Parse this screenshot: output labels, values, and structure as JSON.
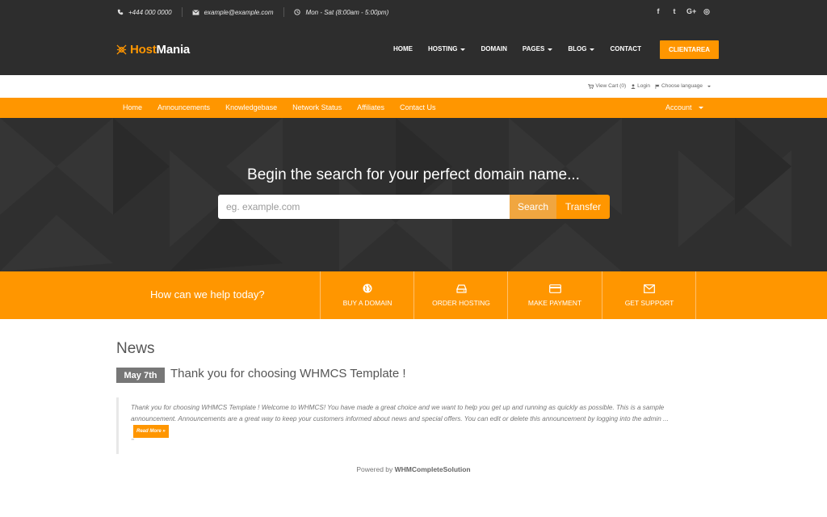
{
  "topbar": {
    "phone": "+444 000 0000",
    "email": "example@example.com",
    "hours": "Mon - Sat (8:00am - 5:00pm)",
    "social": [
      {
        "icon": "facebook-icon",
        "glyph": "f"
      },
      {
        "icon": "twitter-icon",
        "glyph": "t"
      },
      {
        "icon": "google-plus-icon",
        "glyph": "G+"
      },
      {
        "icon": "instagram-icon",
        "glyph": "◎"
      }
    ]
  },
  "brand": {
    "name_part1": "Host",
    "name_part2": "Mania",
    "accent_color": "#ff9600"
  },
  "main_nav": {
    "items": [
      {
        "label": "HOME",
        "dropdown": false
      },
      {
        "label": "HOSTING",
        "dropdown": true
      },
      {
        "label": "DOMAIN",
        "dropdown": false
      },
      {
        "label": "PAGES",
        "dropdown": true
      },
      {
        "label": "BLOG",
        "dropdown": true
      },
      {
        "label": "CONTACT",
        "dropdown": false
      }
    ],
    "client_area": "CLIENTAREA"
  },
  "utility": {
    "cart": "View Cart (0)",
    "login": "Login",
    "language": "Choose language"
  },
  "orange_nav": {
    "items": [
      "Home",
      "Announcements",
      "Knowledgebase",
      "Network Status",
      "Affiliates",
      "Contact Us"
    ],
    "account": "Account"
  },
  "hero": {
    "title": "Begin the search for your perfect domain name...",
    "placeholder": "eg. example.com",
    "search_label": "Search",
    "transfer_label": "Transfer"
  },
  "help": {
    "prompt": "How can we help today?",
    "tiles": [
      {
        "label": "BUY A DOMAIN",
        "icon": "globe-icon"
      },
      {
        "label": "ORDER HOSTING",
        "icon": "server-icon"
      },
      {
        "label": "MAKE PAYMENT",
        "icon": "credit-card-icon"
      },
      {
        "label": "GET SUPPORT",
        "icon": "envelope-icon"
      }
    ]
  },
  "news": {
    "section_title": "News",
    "date": "May 7th",
    "headline": "Thank you for choosing WHMCS Template !",
    "body": "Thank you for choosing WHMCS Template ! Welcome to WHMCS! You have made a great choice and we want to help you get up and running as quickly as possible. This is a sample announcement. Announcements are a great way to keep your customers informed about news and special offers. You can edit or delete this announcement by logging into the admin ...",
    "read_more": "Read More »",
    "quote_mark": "\""
  },
  "footer": {
    "prefix": "Powered by",
    "brand": "WHMCompleteSolution"
  }
}
